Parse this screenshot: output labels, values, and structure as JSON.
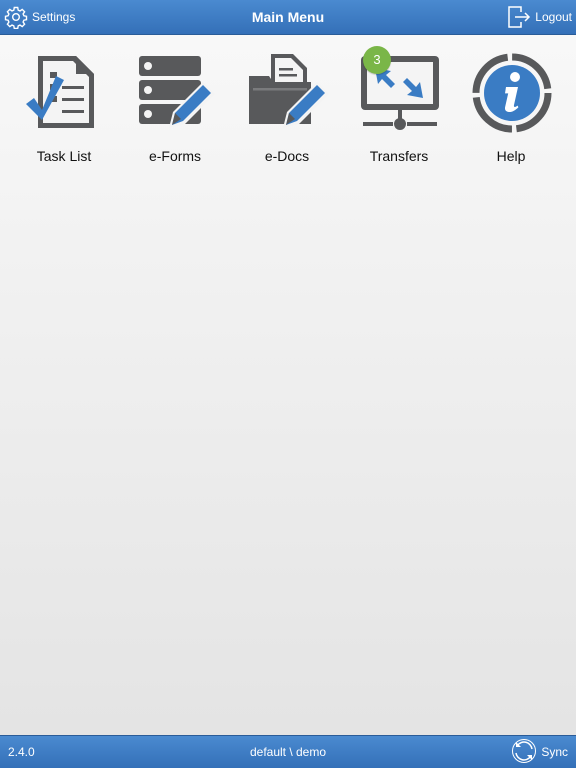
{
  "header": {
    "title": "Main Menu",
    "settings_label": "Settings",
    "logout_label": "Logout",
    "settings_icon": "gear-icon",
    "logout_icon": "logout-icon"
  },
  "menu": {
    "items": [
      {
        "label": "Task List",
        "icon": "task-list-icon"
      },
      {
        "label": "e-Forms",
        "icon": "e-forms-icon"
      },
      {
        "label": "e-Docs",
        "icon": "e-docs-icon"
      },
      {
        "label": "Transfers",
        "icon": "transfers-icon",
        "badge": "3"
      },
      {
        "label": "Help",
        "icon": "info-icon"
      }
    ]
  },
  "footer": {
    "version": "2.4.0",
    "profile": "default \\ demo",
    "sync_label": "Sync",
    "sync_icon": "sync-icon"
  },
  "colors": {
    "bar_blue": "#3a7cc4",
    "icon_gray": "#58595b",
    "icon_blue": "#3a7cc4",
    "badge_green": "#7ab648"
  }
}
